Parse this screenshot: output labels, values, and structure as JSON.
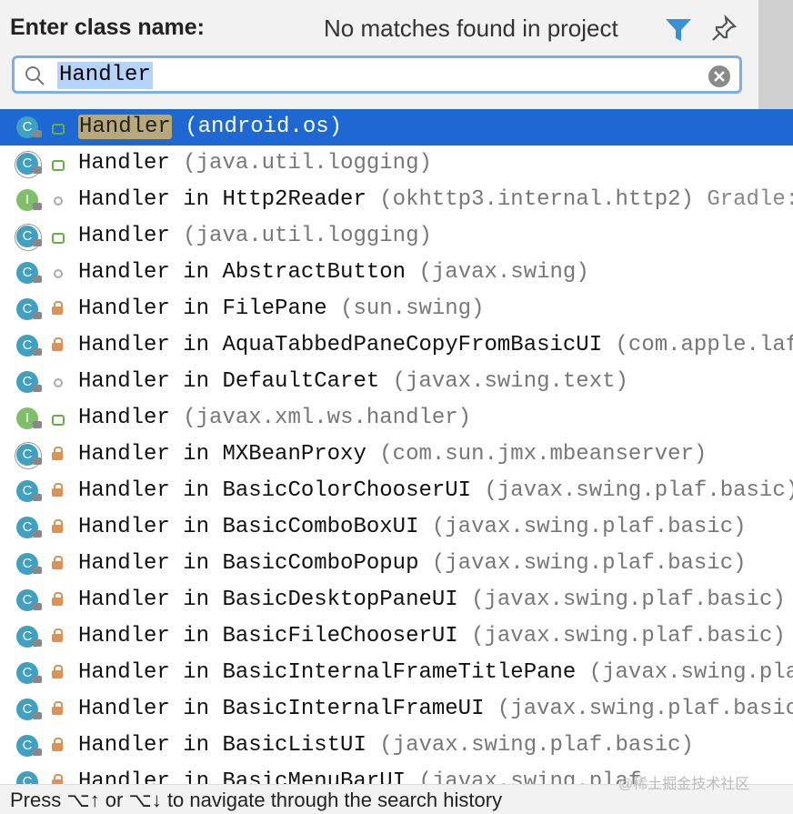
{
  "header": {
    "title": "Enter class name:",
    "status": "No matches found in project"
  },
  "search": {
    "value": "Handler"
  },
  "results": [
    {
      "match": "Handler",
      "rest": "",
      "pkg": "(android.os)",
      "extra": "",
      "kind": "class",
      "vis": "public",
      "selected": true
    },
    {
      "match": "Handler",
      "rest": "",
      "pkg": "(java.util.logging)",
      "extra": "",
      "kind": "abstract",
      "vis": "public"
    },
    {
      "match": "Handler",
      "rest": " in Http2Reader ",
      "pkg": "(okhttp3.internal.http2)",
      "extra": " Gradle:",
      "kind": "interface",
      "vis": "package"
    },
    {
      "match": "Handler",
      "rest": "",
      "pkg": "(java.util.logging)",
      "extra": "",
      "kind": "abstract",
      "vis": "public"
    },
    {
      "match": "Handler",
      "rest": " in AbstractButton ",
      "pkg": "(javax.swing)",
      "extra": "",
      "kind": "class",
      "vis": "package"
    },
    {
      "match": "Handler",
      "rest": " in FilePane ",
      "pkg": "(sun.swing)",
      "extra": "",
      "kind": "class",
      "vis": "private"
    },
    {
      "match": "Handler",
      "rest": " in AquaTabbedPaneCopyFromBasicUI ",
      "pkg": "(com.apple.laf)",
      "extra": "",
      "kind": "class",
      "vis": "private"
    },
    {
      "match": "Handler",
      "rest": " in DefaultCaret ",
      "pkg": "(javax.swing.text)",
      "extra": "",
      "kind": "class",
      "vis": "package"
    },
    {
      "match": "Handler",
      "rest": "",
      "pkg": "(javax.xml.ws.handler)",
      "extra": "",
      "kind": "interface",
      "vis": "public"
    },
    {
      "match": "Handler",
      "rest": " in MXBeanProxy ",
      "pkg": "(com.sun.jmx.mbeanserver)",
      "extra": "",
      "kind": "abstract",
      "vis": "private"
    },
    {
      "match": "Handler",
      "rest": " in BasicColorChooserUI ",
      "pkg": "(javax.swing.plaf.basic)",
      "extra": "",
      "kind": "class",
      "vis": "private"
    },
    {
      "match": "Handler",
      "rest": " in BasicComboBoxUI ",
      "pkg": "(javax.swing.plaf.basic)",
      "extra": "",
      "kind": "class",
      "vis": "private"
    },
    {
      "match": "Handler",
      "rest": " in BasicComboPopup ",
      "pkg": "(javax.swing.plaf.basic)",
      "extra": "",
      "kind": "class",
      "vis": "private"
    },
    {
      "match": "Handler",
      "rest": " in BasicDesktopPaneUI ",
      "pkg": "(javax.swing.plaf.basic)",
      "extra": "",
      "kind": "class",
      "vis": "private"
    },
    {
      "match": "Handler",
      "rest": " in BasicFileChooserUI ",
      "pkg": "(javax.swing.plaf.basic)",
      "extra": "",
      "kind": "class",
      "vis": "private"
    },
    {
      "match": "Handler",
      "rest": " in BasicInternalFrameTitlePane ",
      "pkg": "(javax.swing.plaf",
      "extra": "",
      "kind": "class",
      "vis": "private"
    },
    {
      "match": "Handler",
      "rest": " in BasicInternalFrameUI ",
      "pkg": "(javax.swing.plaf.basic)",
      "extra": "",
      "kind": "class",
      "vis": "private"
    },
    {
      "match": "Handler",
      "rest": " in BasicListUI ",
      "pkg": "(javax.swing.plaf.basic)",
      "extra": "",
      "kind": "class",
      "vis": "private"
    },
    {
      "match": "Handler",
      "rest": " in BasicMenuBarUI ",
      "pkg": "(javax.swing.plaf",
      "extra": "",
      "kind": "class",
      "vis": "private"
    }
  ],
  "footer": {
    "hint": "Press ⌥↑ or ⌥↓ to navigate through the search history"
  },
  "watermark": "@稀土掘金技术社区"
}
